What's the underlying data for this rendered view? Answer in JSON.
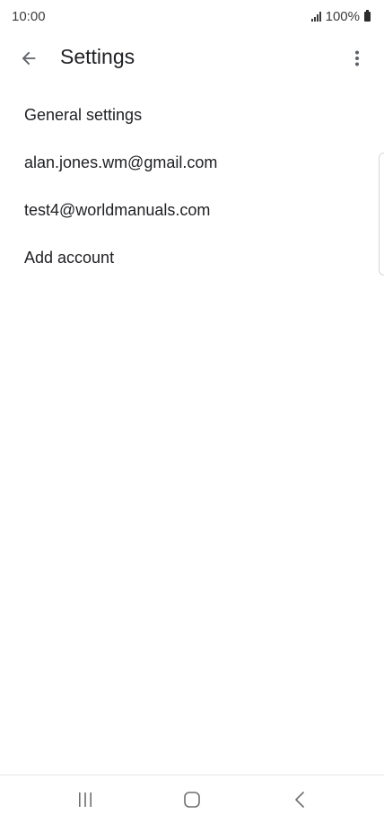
{
  "status_bar": {
    "time": "10:00",
    "battery_text": "100%",
    "icons": [
      "signal-icon",
      "battery-icon"
    ]
  },
  "app_bar": {
    "title": "Settings",
    "back_icon": "arrow-back-icon",
    "more_icon": "more-vert-icon"
  },
  "settings": {
    "items": [
      {
        "label": "General settings"
      },
      {
        "label": "alan.jones.wm@gmail.com"
      },
      {
        "label": "test4@worldmanuals.com"
      },
      {
        "label": "Add account"
      }
    ]
  },
  "nav_bar": {
    "icons": [
      "recents-icon",
      "home-icon",
      "back-icon"
    ]
  },
  "colors": {
    "text": "#202124",
    "status_text": "#3c3c3c",
    "icon": "#5f6368",
    "background": "#ffffff"
  }
}
